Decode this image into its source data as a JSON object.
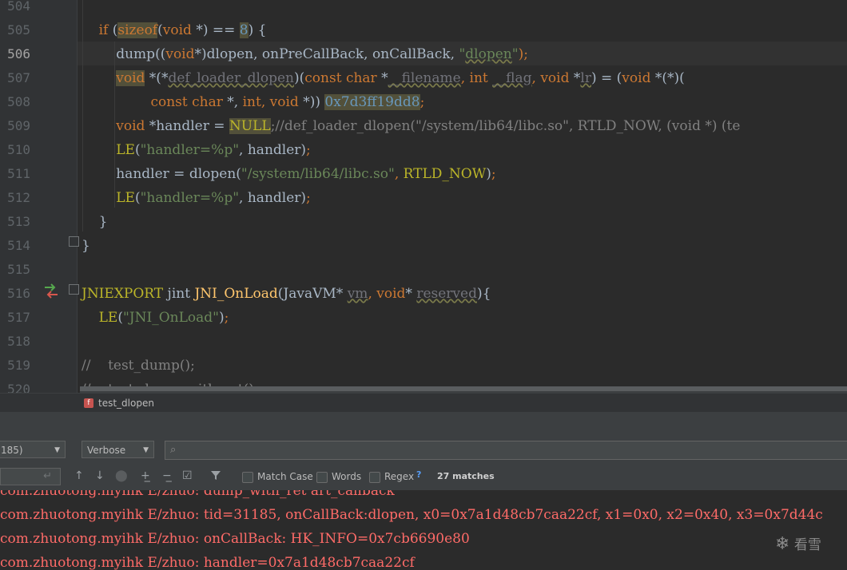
{
  "editor": {
    "line_numbers": [
      "504",
      "505",
      "506",
      "507",
      "508",
      "509",
      "510",
      "511",
      "512",
      "513",
      "514",
      "515",
      "516",
      "517",
      "518",
      "519",
      "520"
    ],
    "current_line": "506",
    "lines": [
      {
        "n": "504",
        "segments": []
      },
      {
        "n": "505",
        "segments": [
          {
            "t": "    if ",
            "c": "kw"
          },
          {
            "t": "(",
            "c": "par"
          },
          {
            "t": "sizeof",
            "c": "kw hl"
          },
          {
            "t": "(",
            "c": "par"
          },
          {
            "t": "void",
            "c": "kw"
          },
          {
            "t": " *) == ",
            "c": "par"
          },
          {
            "t": "8",
            "c": "num hl"
          },
          {
            "t": ") {",
            "c": "par"
          }
        ]
      },
      {
        "n": "506",
        "segments": [
          {
            "t": "        dump((",
            "c": "par"
          },
          {
            "t": "void",
            "c": "kw"
          },
          {
            "t": "*)dlopen, onPreCallBack, onCallBack, ",
            "c": "par"
          },
          {
            "t": "\"",
            "c": "str"
          },
          {
            "t": "dlopen",
            "c": "str warn"
          },
          {
            "t": "\"",
            "c": "str"
          },
          {
            "t": ");",
            "c": "kw"
          }
        ]
      },
      {
        "n": "507",
        "segments": [
          {
            "t": "        ",
            "c": "par"
          },
          {
            "t": "void",
            "c": "kw hl"
          },
          {
            "t": " *(*",
            "c": "par"
          },
          {
            "t": "def_loader_dlopen",
            "c": "dim warn"
          },
          {
            "t": ")(",
            "c": "par"
          },
          {
            "t": "const char",
            "c": "kw"
          },
          {
            "t": " *",
            "c": "par"
          },
          {
            "t": "__filename",
            "c": "dim warn"
          },
          {
            "t": ", ",
            "c": "kw"
          },
          {
            "t": "int",
            "c": "kw"
          },
          {
            "t": " ",
            "c": "par"
          },
          {
            "t": "__flag",
            "c": "dim warn"
          },
          {
            "t": ", ",
            "c": "kw"
          },
          {
            "t": "void",
            "c": "kw"
          },
          {
            "t": " *",
            "c": "par"
          },
          {
            "t": "lr",
            "c": "dim warn"
          },
          {
            "t": ") = (",
            "c": "par"
          },
          {
            "t": "void",
            "c": "kw"
          },
          {
            "t": " *(*)(",
            "c": "par"
          }
        ]
      },
      {
        "n": "508",
        "segments": [
          {
            "t": "                ",
            "c": "par"
          },
          {
            "t": "const char",
            "c": "kw"
          },
          {
            "t": " *, ",
            "c": "par"
          },
          {
            "t": "int",
            "c": "kw"
          },
          {
            "t": ", ",
            "c": "kw"
          },
          {
            "t": "void",
            "c": "kw"
          },
          {
            "t": " *)) ",
            "c": "par"
          },
          {
            "t": "0x7d3ff19dd8",
            "c": "num hl"
          },
          {
            "t": ";",
            "c": "kw"
          }
        ]
      },
      {
        "n": "509",
        "segments": [
          {
            "t": "        ",
            "c": "par"
          },
          {
            "t": "void",
            "c": "kw"
          },
          {
            "t": " *handler = ",
            "c": "par"
          },
          {
            "t": "NULL",
            "c": "mac hl"
          },
          {
            "t": ";//def_loader_dlopen(\"/system/lib64/libc.so\", RTLD_NOW, (void *) (te",
            "c": "cmt"
          }
        ]
      },
      {
        "n": "510",
        "segments": [
          {
            "t": "        ",
            "c": "par"
          },
          {
            "t": "LE",
            "c": "mac"
          },
          {
            "t": "(",
            "c": "par"
          },
          {
            "t": "\"handler=%p\"",
            "c": "str"
          },
          {
            "t": ", handler)",
            "c": "par"
          },
          {
            "t": ";",
            "c": "kw"
          }
        ]
      },
      {
        "n": "511",
        "segments": [
          {
            "t": "        handler = dlopen(",
            "c": "par"
          },
          {
            "t": "\"/system/lib64/libc.so\"",
            "c": "str"
          },
          {
            "t": ", ",
            "c": "kw"
          },
          {
            "t": "RTLD_NOW",
            "c": "mac"
          },
          {
            "t": ")",
            "c": "par"
          },
          {
            "t": ";",
            "c": "kw"
          }
        ]
      },
      {
        "n": "512",
        "segments": [
          {
            "t": "        ",
            "c": "par"
          },
          {
            "t": "LE",
            "c": "mac"
          },
          {
            "t": "(",
            "c": "par"
          },
          {
            "t": "\"handler=%p\"",
            "c": "str"
          },
          {
            "t": ", handler)",
            "c": "par"
          },
          {
            "t": ";",
            "c": "kw"
          }
        ]
      },
      {
        "n": "513",
        "segments": [
          {
            "t": "    }",
            "c": "par"
          }
        ]
      },
      {
        "n": "514",
        "segments": [
          {
            "t": "}",
            "c": "par"
          }
        ]
      },
      {
        "n": "515",
        "segments": []
      },
      {
        "n": "516",
        "segments": [
          {
            "t": "JNIEXPORT",
            "c": "mac"
          },
          {
            "t": " jint ",
            "c": "par"
          },
          {
            "t": "JNI_OnLoad",
            "c": "fn"
          },
          {
            "t": "(JavaVM* ",
            "c": "par"
          },
          {
            "t": "vm",
            "c": "dim warn"
          },
          {
            "t": ", ",
            "c": "kw"
          },
          {
            "t": "void",
            "c": "kw"
          },
          {
            "t": "* ",
            "c": "par"
          },
          {
            "t": "reserved",
            "c": "dim warn"
          },
          {
            "t": "){",
            "c": "par"
          }
        ]
      },
      {
        "n": "517",
        "segments": [
          {
            "t": "    ",
            "c": "par"
          },
          {
            "t": "LE",
            "c": "mac"
          },
          {
            "t": "(",
            "c": "par"
          },
          {
            "t": "\"JNI_OnLoad\"",
            "c": "str"
          },
          {
            "t": ")",
            "c": "par"
          },
          {
            "t": ";",
            "c": "kw"
          }
        ]
      },
      {
        "n": "518",
        "segments": []
      },
      {
        "n": "519",
        "segments": [
          {
            "t": "//    test_dump();",
            "c": "cmt"
          }
        ]
      },
      {
        "n": "520",
        "segments": [
          {
            "t": "//    test_dump_with_ret();",
            "c": "cmt"
          }
        ]
      }
    ]
  },
  "breadcrumb": {
    "badge": "f",
    "label": "test_dlopen"
  },
  "toolbar": {
    "process_value": "185)",
    "level_value": "Verbose",
    "search_placeholder": "",
    "filter_value": "",
    "match_case": "Match Case",
    "words": "Words",
    "regex": "Regex",
    "help": "?",
    "matches": "27 matches"
  },
  "log": {
    "lines": [
      "com.zhuotong.myihk E/zhuo: dump_with_ret art_callback",
      "com.zhuotong.myihk E/zhuo: tid=31185, onCallBack:dlopen, x0=0x7a1d48cb7caa22cf, x1=0x0, x2=0x40, x3=0x7d44c",
      "com.zhuotong.myihk E/zhuo: onCallBack: HK_INFO=0x7cb6690e80",
      "com.zhuotong.myihk E/zhuo: handler=0x7a1d48cb7caa22cf"
    ]
  },
  "watermark": {
    "icon": "snowflake-icon",
    "text": "看雪"
  },
  "colors": {
    "keyword": "#cc7832",
    "string": "#6a8759",
    "number": "#6897bb",
    "macro": "#bbb529",
    "function": "#ffc66d",
    "log_error": "#ff6b68"
  }
}
